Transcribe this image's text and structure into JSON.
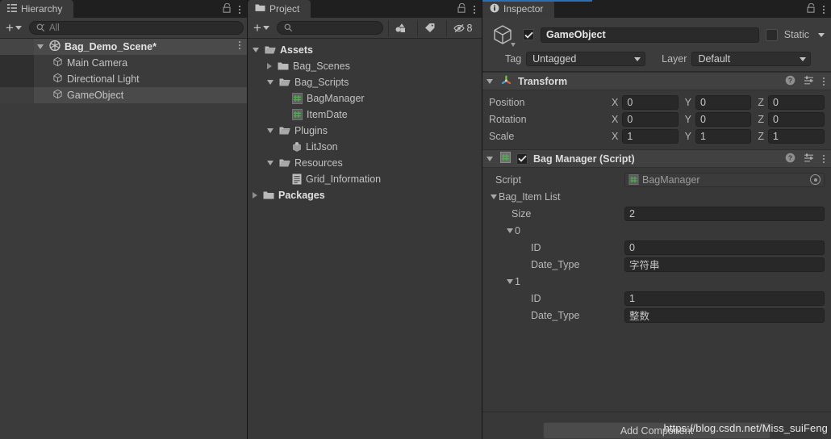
{
  "accent": "#2c6fb5",
  "hierarchy": {
    "tab_label": "Hierarchy",
    "tab_icon": "hierarchy-icon",
    "lock_icon": "lock-icon",
    "menu_icon": "kebab-menu-icon",
    "add_label": "+",
    "search_placeholder": "All",
    "search_value": "",
    "rows": [
      {
        "label": "Bag_Demo_Scene*",
        "icon": "scene-icon",
        "indent": 0,
        "expander": "down",
        "state": "scene",
        "has_menu": true
      },
      {
        "label": "Main Camera",
        "icon": "gameobject-cube-icon",
        "indent": 1,
        "expander": "none",
        "state": "normal",
        "has_menu": false
      },
      {
        "label": "Directional Light",
        "icon": "gameobject-cube-icon",
        "indent": 1,
        "expander": "none",
        "state": "normal",
        "has_menu": false
      },
      {
        "label": "GameObject",
        "icon": "gameobject-cube-icon",
        "indent": 1,
        "expander": "none",
        "state": "selected",
        "has_menu": false
      }
    ]
  },
  "project": {
    "tab_label": "Project",
    "tab_icon": "folder-icon",
    "lock_icon": "lock-icon",
    "menu_icon": "kebab-menu-icon",
    "add_label": "+",
    "search_placeholder": "",
    "search_value": "",
    "toolbar_buttons": [
      {
        "name": "favorites-filter-icon",
        "label": ""
      },
      {
        "name": "label-tag-filter-icon",
        "label": ""
      },
      {
        "name": "hidden-packages-icon",
        "label": "8"
      }
    ],
    "rows": [
      {
        "label": "Assets",
        "icon": "folder-open-icon",
        "indent": 0,
        "expander": "down",
        "bold": true
      },
      {
        "label": "Bag_Scenes",
        "icon": "folder-icon",
        "indent": 1,
        "expander": "right",
        "bold": false
      },
      {
        "label": "Bag_Scripts",
        "icon": "folder-open-icon",
        "indent": 1,
        "expander": "down",
        "bold": false
      },
      {
        "label": "BagManager",
        "icon": "csharp-script-icon",
        "indent": 2,
        "expander": "none",
        "bold": false
      },
      {
        "label": "ItemDate",
        "icon": "csharp-script-icon",
        "indent": 2,
        "expander": "none",
        "bold": false
      },
      {
        "label": "Plugins",
        "icon": "folder-open-icon",
        "indent": 1,
        "expander": "down",
        "bold": false
      },
      {
        "label": "LitJson",
        "icon": "dll-assembly-icon",
        "indent": 2,
        "expander": "none",
        "bold": false
      },
      {
        "label": "Resources",
        "icon": "folder-open-icon",
        "indent": 1,
        "expander": "down",
        "bold": false
      },
      {
        "label": "Grid_Information",
        "icon": "text-asset-icon",
        "indent": 2,
        "expander": "none",
        "bold": false
      },
      {
        "label": "Packages",
        "icon": "folder-icon",
        "indent": 0,
        "expander": "right",
        "bold": true
      }
    ]
  },
  "inspector": {
    "tab_label": "Inspector",
    "tab_icon": "info-icon",
    "lock_icon": "lock-icon",
    "menu_icon": "kebab-menu-icon",
    "gameobject": {
      "icon": "gameobject-cube-icon",
      "enabled": true,
      "name": "GameObject",
      "static_label": "Static",
      "static_checked": false,
      "tag_label": "Tag",
      "tag_value": "Untagged",
      "layer_label": "Layer",
      "layer_value": "Default"
    },
    "transform": {
      "title": "Transform",
      "icon": "transform-axis-icon",
      "expanded": true,
      "help_icon": "help-icon",
      "preset_icon": "preset-sliders-icon",
      "menu_icon": "kebab-menu-icon",
      "rows": [
        {
          "label": "Position",
          "x": "0",
          "y": "0",
          "z": "0"
        },
        {
          "label": "Rotation",
          "x": "0",
          "y": "0",
          "z": "0"
        },
        {
          "label": "Scale",
          "x": "1",
          "y": "1",
          "z": "1"
        }
      ],
      "axis_labels": {
        "x": "X",
        "y": "Y",
        "z": "Z"
      }
    },
    "bag_manager": {
      "title": "Bag Manager (Script)",
      "icon": "csharp-script-icon",
      "enabled": true,
      "expanded": true,
      "help_icon": "help-icon",
      "preset_icon": "preset-sliders-icon",
      "menu_icon": "kebab-menu-icon",
      "script_label": "Script",
      "script_value": "BagManager",
      "script_picker_icon": "object-picker-icon",
      "list_label": "Bag_Item List",
      "size_label": "Size",
      "size_value": "2",
      "elements": [
        {
          "index": "0",
          "fields": [
            {
              "label": "ID",
              "value": "0"
            },
            {
              "label": "Date_Type",
              "value": "字符串"
            }
          ]
        },
        {
          "index": "1",
          "fields": [
            {
              "label": "ID",
              "value": "1"
            },
            {
              "label": "Date_Type",
              "value": "整数"
            }
          ]
        }
      ]
    },
    "add_component_label": "Add Component"
  },
  "watermark": "https://blog.csdn.net/Miss_suiFeng"
}
